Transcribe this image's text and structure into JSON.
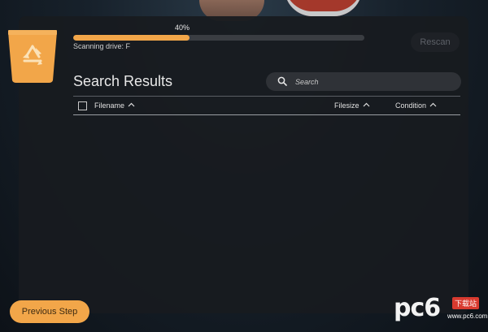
{
  "scan": {
    "progress_label": "40%",
    "progress_value": 40,
    "status": "Scanning drive: F",
    "rescan_label": "Rescan"
  },
  "results": {
    "title": "Search Results",
    "search_placeholder": "Search",
    "columns": {
      "filename": "Filename",
      "filesize": "Filesize",
      "condition": "Condition"
    },
    "rows": []
  },
  "footer": {
    "previous_label": "Previous Step"
  },
  "watermark": {
    "letters": "pc6",
    "badge": "下载站",
    "sub": "www.pc6.com"
  },
  "icons": {
    "app": "recycle-bin-icon",
    "search": "search-icon",
    "sort": "chevron-up-icon"
  },
  "colors": {
    "accent": "#f2a649",
    "panel": "#181b1f",
    "text": "#e8e8e8"
  }
}
